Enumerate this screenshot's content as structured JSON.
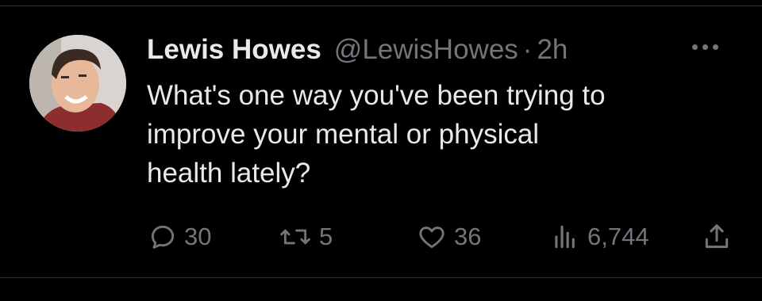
{
  "tweet": {
    "author_name": "Lewis Howes",
    "handle": "@LewisHowes",
    "separator": "·",
    "time": "2h",
    "text": "What's one way you've been trying to\nimprove your mental or physical\nhealth lately?",
    "more_icon": "more-horizontal-icon"
  },
  "actions": {
    "replies": {
      "icon": "reply-icon",
      "count": "30"
    },
    "retweets": {
      "icon": "retweet-icon",
      "count": "5"
    },
    "likes": {
      "icon": "heart-icon",
      "count": "36"
    },
    "views": {
      "icon": "views-chart-icon",
      "count": "6,744"
    },
    "share": {
      "icon": "share-icon"
    }
  },
  "colors": {
    "background": "#000000",
    "primary_text": "#e7e9ea",
    "secondary_text": "#71767b",
    "divider": "#2f3336"
  }
}
